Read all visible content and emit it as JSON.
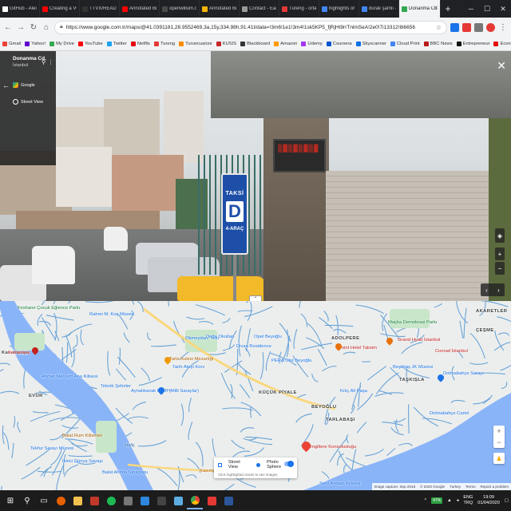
{
  "browser": {
    "tabs": [
      {
        "label": "GitHub - AlexeyA",
        "color": "#ffffff"
      },
      {
        "label": "Creating a VOLO",
        "color": "#ff0000"
      },
      {
        "label": "TTVX/README.m",
        "color": "#333333"
      },
      {
        "label": "Annotated Bibliog",
        "color": "#ff0000"
      },
      {
        "label": "openwillum.ocu",
        "color": "#4a4a4a"
      },
      {
        "label": "Annotated Bibliog",
        "color": "#f4b400"
      },
      {
        "label": "Contact - Earlybird",
        "color": "#999999"
      },
      {
        "label": "Tureng - ortaya",
        "color": "#e53935"
      },
      {
        "label": "highlights or high",
        "color": "#4285f4"
      },
      {
        "label": "durak şamlı - Go",
        "color": "#4285f4"
      },
      {
        "label": "Donanma Cd, İst",
        "color": "#34a853",
        "active": true
      }
    ],
    "new_tab_label": "+",
    "url": "https://www.google.com.tr/maps/@41.0391181,28.9552469,3a,15y,334.98h,91.41t/data=!3m6!1e1!3m4!1sk5KP5_fjRjHt9rrTnlmSeA!2e0!7i13312!8i6656",
    "bookmarks": [
      {
        "label": "Gmail",
        "color": "#ea4335"
      },
      {
        "label": "Yahoo!",
        "color": "#6001d2"
      },
      {
        "label": "My Drive",
        "color": "#34a853"
      },
      {
        "label": "YouTube",
        "color": "#ff0000"
      },
      {
        "label": "Twitter",
        "color": "#1da1f2"
      },
      {
        "label": "Netflix",
        "color": "#e50914"
      },
      {
        "label": "Tureng",
        "color": "#e53935"
      },
      {
        "label": "Turuncuarize",
        "color": "#fb8c00"
      },
      {
        "label": "KUSIS",
        "color": "#c62828"
      },
      {
        "label": "Blackboard",
        "color": "#333333"
      },
      {
        "label": "Amazon",
        "color": "#ff9900"
      },
      {
        "label": "Udemy",
        "color": "#a435f0"
      },
      {
        "label": "Coursera",
        "color": "#0056d2"
      },
      {
        "label": "Skyscanner",
        "color": "#0770e3"
      },
      {
        "label": "Cloud Print",
        "color": "#4285f4"
      },
      {
        "label": "BBC News",
        "color": "#bb1919"
      },
      {
        "label": "Entrepreneur",
        "color": "#111111"
      },
      {
        "label": "Economist",
        "color": "#e3120b"
      },
      {
        "label": "Dövizi",
        "color": "#0b5394"
      },
      {
        "label": "Codecademy",
        "color": "#1f2d3d"
      },
      {
        "label": "documentary",
        "color": "#222222"
      }
    ]
  },
  "streetview": {
    "place_title": "Donanma Cd.",
    "place_subtitle": "İstanbul",
    "google_label": "Google",
    "mode_label": "Street View",
    "sign_text": "TAKSİ",
    "sign_letter": "D",
    "sign_sub": "4-ARAÇ",
    "led_text": "▒▓▒▓▒▓▒▓"
  },
  "map": {
    "labels": [
      {
        "text": "Feshane Çocuk Eğlence Parkı",
        "cls": "green",
        "lines": [
          "Feshane Çocuk",
          "Eğlence Parkı"
        ]
      },
      {
        "text": "Rahmi M. Koç Müzesi",
        "cls": "blue"
      },
      {
        "text": "Kasımpaşa",
        "cls": "dark"
      },
      {
        "text": "Okmeydanı Yolu",
        "cls": "blue"
      },
      {
        "text": "Doğa Okulları",
        "cls": "blue"
      },
      {
        "text": "Opel Beyoğlu",
        "cls": "blue"
      },
      {
        "text": "Divan Residence",
        "cls": "blue"
      },
      {
        "text": "Maçka Demokrasi Parkı",
        "cls": "green"
      },
      {
        "text": "AKARETLER",
        "cls": "dark"
      },
      {
        "text": "ÇEŞME",
        "cls": "dark"
      },
      {
        "text": "ADOLPERE",
        "cls": "dark"
      },
      {
        "text": "Point Hotel Taksim",
        "cls": "pink"
      },
      {
        "text": "Grand Hyatt İstanbul",
        "cls": "pink"
      },
      {
        "text": "Conrad İstanbul",
        "cls": "pink"
      },
      {
        "text": "Kemankeş",
        "cls": "pink"
      },
      {
        "text": "Ahmet Meryem Ana Kilisesi",
        "cls": "blue"
      },
      {
        "text": "Tarla Kulesi Mezarlığı",
        "cls": "orange"
      },
      {
        "text": "Tarih Ateşi Korv",
        "cls": "blue"
      },
      {
        "text": "Aynalıkavak Kasrı (Milli Saraylar)",
        "cls": "blue"
      },
      {
        "text": "PERA Otel Beyoğlu",
        "cls": "blue"
      },
      {
        "text": "Kılıç Ali Paşa",
        "cls": "blue"
      },
      {
        "text": "Beşiktaş JK Müzesi",
        "cls": "blue"
      },
      {
        "text": "Dolmabahçe Sarayı",
        "cls": "blue"
      },
      {
        "text": "TAŞKIŞLA",
        "cls": "dark"
      },
      {
        "text": "Dolmabahçe Camii",
        "cls": "blue"
      },
      {
        "text": "EVÜR",
        "cls": "dark"
      },
      {
        "text": "KÜÇÜK PİYALE",
        "cls": "dark"
      },
      {
        "text": "BEYOĞLU",
        "cls": "dark"
      },
      {
        "text": "TARLABAŞI",
        "cls": "dark"
      },
      {
        "text": "Teknik Şehirler",
        "cls": "blue"
      },
      {
        "text": "Balat Rum Kiliseleri",
        "cls": "orange"
      },
      {
        "text": "Tekfur Sarayı Müzesi",
        "cls": "blue"
      },
      {
        "text": "Haliç",
        "cls": "water"
      },
      {
        "text": "Balat Ahrida Sinagogu",
        "cls": "blue"
      },
      {
        "text": "İkinci Dünya Savaşı",
        "cls": "blue"
      },
      {
        "text": "Kasımpaşa Deniz Kuvvetleri",
        "cls": "orange"
      },
      {
        "text": "Sent Antuan Kilisesi",
        "cls": "blue"
      },
      {
        "text": "Ingiltere Konsolosluğu",
        "cls": "pink"
      }
    ],
    "streetview_panel": {
      "opt1": "Street View",
      "opt2": "Photo Sphere",
      "hint": "Click highlighted areas to see images"
    },
    "footer": [
      "Image capture: Sep 2018",
      "© 2020 Google",
      "Turkey",
      "Terms",
      "Report a problem"
    ]
  },
  "taskbar": {
    "battery": "47%",
    "lang_top": "ENG",
    "lang_bottom": "TRQ",
    "time": "19:09",
    "date": "01/04/2020"
  }
}
